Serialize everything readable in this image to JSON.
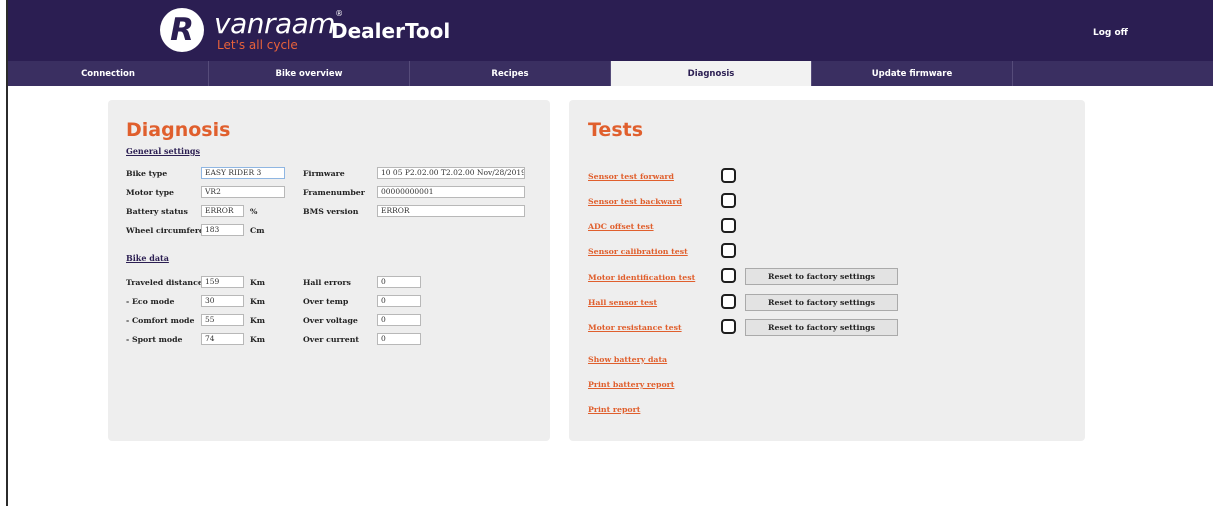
{
  "header": {
    "logo_letter": "R",
    "brand": "vanraam",
    "brand_mark": "®",
    "tagline": "Let's all cycle",
    "app_title": "DealerTool",
    "logoff": "Log off",
    "colors": {
      "header_bg": "#2b1e52",
      "accent": "#e05f2d"
    }
  },
  "tabs": [
    "Connection",
    "Bike overview",
    "Recipes",
    "Diagnosis",
    "Update firmware"
  ],
  "active_tab": "Diagnosis",
  "diagnosis": {
    "title": "Diagnosis",
    "general_settings": {
      "heading": "General settings",
      "bike_type": {
        "label": "Bike type",
        "value": "EASY RIDER 3"
      },
      "motor_type": {
        "label": "Motor type",
        "value": "VR2"
      },
      "battery_status": {
        "label": "Battery status",
        "value": "ERROR",
        "unit": "%"
      },
      "wheel_circumference": {
        "label": "Wheel circumference",
        "value": "183",
        "unit": "Cm"
      },
      "firmware": {
        "label": "Firmware",
        "value": "10 05 P2.02.00 T2.02.00 Nov/28/2019"
      },
      "framenumber": {
        "label": "Framenumber",
        "value": "00000000001"
      },
      "bms_version": {
        "label": "BMS version",
        "value": "ERROR"
      }
    },
    "bike_data": {
      "heading": "Bike data",
      "traveled_distance": {
        "label": "Traveled distance",
        "value": "159",
        "unit": "Km"
      },
      "eco_mode": {
        "label": "- Eco mode",
        "value": "30",
        "unit": "Km"
      },
      "comfort_mode": {
        "label": "- Comfort mode",
        "value": "55",
        "unit": "Km"
      },
      "sport_mode": {
        "label": "- Sport mode",
        "value": "74",
        "unit": "Km"
      },
      "hall_errors": {
        "label": "Hall errors",
        "value": "0"
      },
      "over_temp": {
        "label": "Over temp",
        "value": "0"
      },
      "over_voltage": {
        "label": "Over voltage",
        "value": "0"
      },
      "over_current": {
        "label": "Over current",
        "value": "0"
      }
    }
  },
  "tests": {
    "title": "Tests",
    "items": [
      {
        "label": "Sensor test forward",
        "checked": false
      },
      {
        "label": "Sensor test backward",
        "checked": false
      },
      {
        "label": "ADC offset test",
        "checked": false
      },
      {
        "label": "Sensor calibration test",
        "checked": false
      },
      {
        "label": "Motor identification test",
        "checked": false,
        "button": "Reset to factory settings"
      },
      {
        "label": "Hall sensor test",
        "checked": false,
        "button": "Reset to factory settings"
      },
      {
        "label": "Motor resistance test",
        "checked": false,
        "button": "Reset to factory settings"
      }
    ],
    "links": {
      "show_battery_data": "Show battery data",
      "print_battery_report": "Print battery report",
      "print_report": "Print report"
    }
  }
}
